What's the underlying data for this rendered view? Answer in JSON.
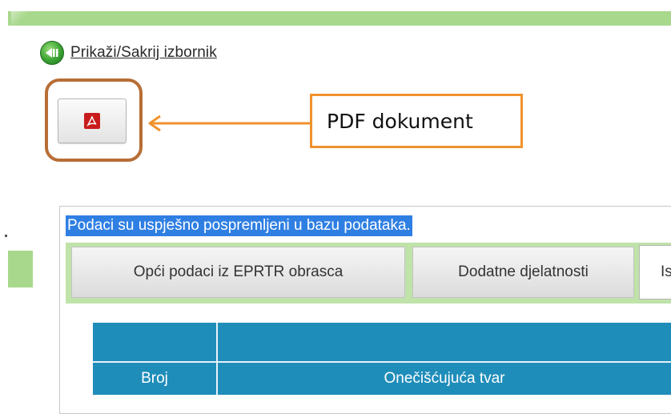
{
  "header": {
    "toggle_menu_label": "Prikaži/Sakrij izbornik"
  },
  "toolbar": {
    "pdf_button_icon": "pdf-icon",
    "callout_text": "PDF dokument"
  },
  "panel": {
    "success_message": "Podaci su uspješno pospremljeni u bazu podataka.",
    "tabs": [
      {
        "label": "Opći podaci iz EPRTR obrasca",
        "active": false
      },
      {
        "label": "Dodatne djelatnosti",
        "active": false
      },
      {
        "label": "Is",
        "active": true
      }
    ],
    "table": {
      "columns": [
        "Broj",
        "Onečišćujuća tvar"
      ]
    }
  },
  "colors": {
    "accent_green": "#a8d88c",
    "highlight_border": "#b76e36",
    "callout_border": "#f0922e",
    "selection_blue": "#2f7fe3",
    "table_header": "#1f8dba"
  }
}
